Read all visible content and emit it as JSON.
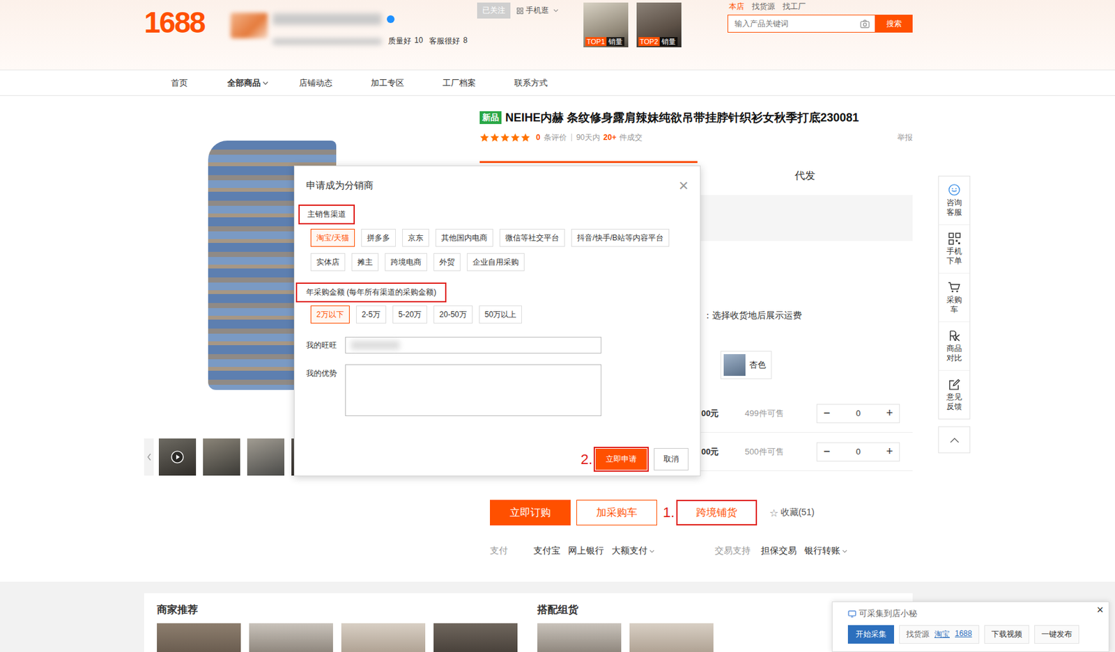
{
  "header": {
    "logo": "1688",
    "shop": {
      "name_blurred": true,
      "verified": true,
      "stats": [
        {
          "label": "质量好",
          "value": "10"
        },
        {
          "label": "客服很好",
          "value": "8"
        }
      ]
    },
    "follow": "已关注",
    "mobile": "手机逛",
    "top_items": [
      {
        "rank": "TOP1",
        "label": "销量"
      },
      {
        "rank": "TOP2",
        "label": "销量"
      }
    ],
    "search_tabs": [
      {
        "label": "本店",
        "selected": true
      },
      {
        "label": "找货源",
        "selected": false
      },
      {
        "label": "找工厂",
        "selected": false
      }
    ],
    "search_placeholder": "输入产品关键词",
    "search_button": "搜索"
  },
  "nav": [
    {
      "label": "首页",
      "selected": false,
      "dropdown": false
    },
    {
      "label": "全部商品",
      "selected": true,
      "dropdown": true
    },
    {
      "label": "店铺动态",
      "selected": false,
      "dropdown": false
    },
    {
      "label": "加工专区",
      "selected": false,
      "dropdown": false
    },
    {
      "label": "工厂档案",
      "selected": false,
      "dropdown": false
    },
    {
      "label": "联系方式",
      "selected": false,
      "dropdown": false
    }
  ],
  "product": {
    "badge": "新品",
    "title": "NEIHE内赫 条纹修身露肩辣妹纯欲吊带挂脖针织衫女秋季打底230081",
    "stars": 5,
    "review_count": "0",
    "review_label": "条评价",
    "period": "90天内",
    "sold": "20+",
    "sold_label": "件成交",
    "report": "举报"
  },
  "gallery": {
    "thumbnails": [
      {
        "video": true
      },
      {
        "video": false
      },
      {
        "video": false
      },
      {
        "video": false
      }
    ]
  },
  "purchase_tabs": [
    {
      "label": "",
      "selected": true
    },
    {
      "label": "代发",
      "selected": false
    }
  ],
  "shipping_note": "：选择收货地后展示运费",
  "color_options": [
    {
      "label": "杏色",
      "selected": false
    }
  ],
  "skus": [
    {
      "price": "00元",
      "stock": "499件可售",
      "quantity": "0"
    },
    {
      "price": "00元",
      "stock": "500件可售",
      "quantity": "0"
    }
  ],
  "quantity_minus": "−",
  "quantity_plus": "+",
  "actions": [
    {
      "label": "立即订购",
      "kind": "primary",
      "step": "",
      "highlighted": false
    },
    {
      "label": "加采购车",
      "kind": "outline",
      "step": "",
      "highlighted": false
    },
    {
      "label": "跨境铺货",
      "kind": "outline",
      "step": "1.",
      "highlighted": true
    }
  ],
  "favorite": {
    "icon": "☆",
    "label": "收藏(51)"
  },
  "payment": {
    "label": "支付",
    "methods": [
      {
        "label": "支付宝",
        "dropdown": false
      },
      {
        "label": "网上银行",
        "dropdown": false
      },
      {
        "label": "大额支付",
        "dropdown": true
      }
    ]
  },
  "trade": {
    "label": "交易支持",
    "methods": [
      {
        "label": "担保交易",
        "dropdown": false
      },
      {
        "label": "银行转账",
        "dropdown": true
      }
    ]
  },
  "modal": {
    "title": "申请成为分销商",
    "close": "×",
    "channel_label": "主销售渠道",
    "channels": [
      {
        "label": "淘宝/天猫",
        "selected": true
      },
      {
        "label": "拼多多",
        "selected": false
      },
      {
        "label": "京东",
        "selected": false
      },
      {
        "label": "其他国内电商",
        "selected": false
      },
      {
        "label": "微信等社交平台",
        "selected": false
      },
      {
        "label": "抖音/快手/B站等内容平台",
        "selected": false
      },
      {
        "label": "实体店",
        "selected": false
      },
      {
        "label": "摊主",
        "selected": false
      },
      {
        "label": "跨境电商",
        "selected": false
      },
      {
        "label": "外贸",
        "selected": false
      },
      {
        "label": "企业自用采购",
        "selected": false
      }
    ],
    "amount_label": "年采购金额 (每年所有渠道的采购金额)",
    "amounts": [
      {
        "label": "2万以下",
        "selected": true
      },
      {
        "label": "2-5万",
        "selected": false
      },
      {
        "label": "5-20万",
        "selected": false
      },
      {
        "label": "20-50万",
        "selected": false
      },
      {
        "label": "50万以上",
        "selected": false
      }
    ],
    "wangwang_label": "我的旺旺",
    "wangwang_blurred": true,
    "advantage_label": "我的优势",
    "submit_step": "2.",
    "submit": "立即申请",
    "cancel": "取消"
  },
  "side_tools": [
    {
      "label": "咨询客服",
      "kind": "service"
    },
    {
      "label": "手机下单",
      "kind": "mobile"
    },
    {
      "label": "采购车",
      "kind": "cart"
    },
    {
      "label": "商品对比",
      "kind": "compare"
    },
    {
      "label": "意见反馈",
      "kind": "feedback"
    }
  ],
  "sections": [
    {
      "title": "商家推荐",
      "tiles": 4
    },
    {
      "title": "搭配组货",
      "tiles": 2
    }
  ],
  "collector": {
    "title": "可采集到店小秘",
    "close": "×",
    "start": "开始采集",
    "source_label": "找货源",
    "sources": [
      "淘宝",
      "1688"
    ],
    "download": "下载视频",
    "publish": "一键发布"
  }
}
